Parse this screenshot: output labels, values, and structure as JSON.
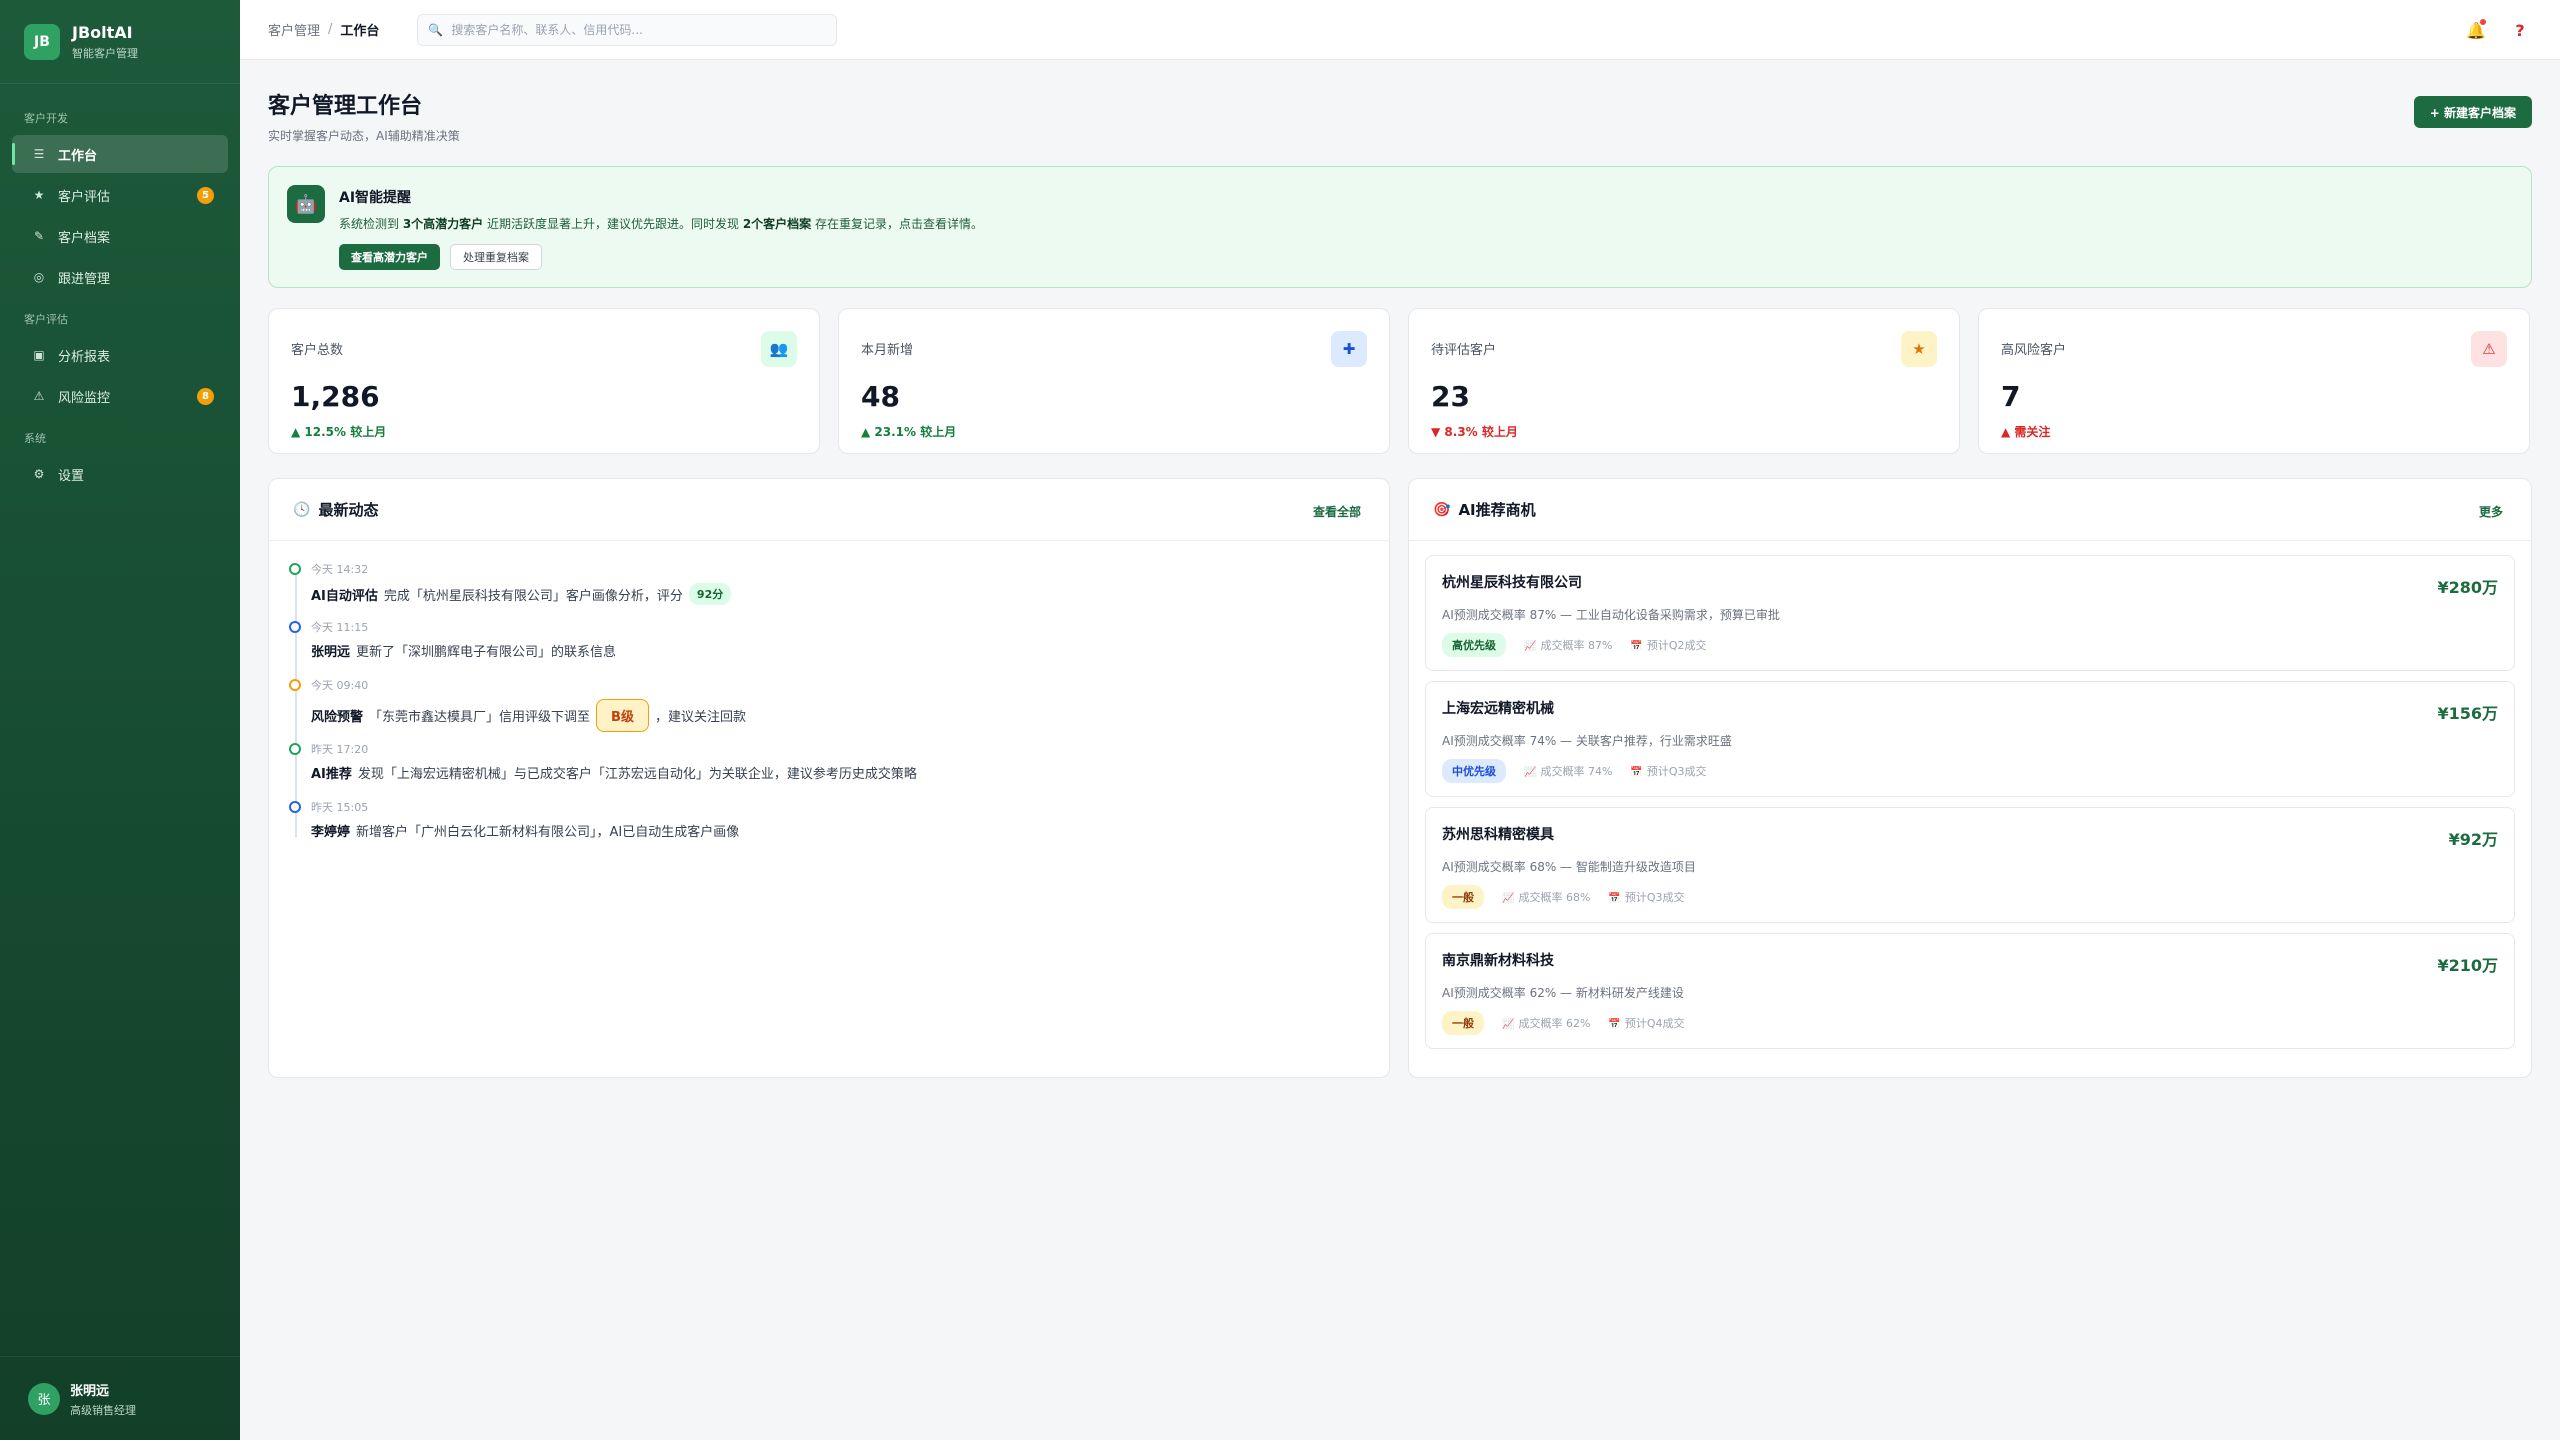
{
  "brand": {
    "logo": "JB",
    "name": "JBoltAI",
    "subtitle": "智能客户管理"
  },
  "sidebar": {
    "sections": [
      {
        "title": "客户开发",
        "items": [
          {
            "label": "工作台",
            "icon": "menu-icon",
            "active": true
          },
          {
            "label": "客户评估",
            "icon": "star-icon",
            "badge": "5"
          },
          {
            "label": "客户档案",
            "icon": "pen-icon"
          },
          {
            "label": "跟进管理",
            "icon": "target-icon"
          }
        ]
      },
      {
        "title": "客户评估",
        "items": [
          {
            "label": "分析报表",
            "icon": "report-icon"
          },
          {
            "label": "风险监控",
            "icon": "warning-icon",
            "badge": "8"
          }
        ]
      },
      {
        "title": "系统",
        "items": [
          {
            "label": "设置",
            "icon": "gear-icon"
          }
        ]
      }
    ]
  },
  "user": {
    "avatar": "张",
    "name": "张明远",
    "role": "高级销售经理"
  },
  "topbar": {
    "breadcrumb": [
      "客户管理",
      "工作台"
    ],
    "breadcrumb_sep": "/",
    "search_placeholder": "搜索客户名称、联系人、信用代码..."
  },
  "page": {
    "title": "客户管理工作台",
    "subtitle": "实时掌握客户动态，AI辅助精准决策",
    "new_button": "+ 新建客户档案"
  },
  "ai_alert": {
    "title": "AI智能提醒",
    "text_1": "系统检测到 ",
    "bold_1": "3个高潜力客户",
    "text_2": " 近期活跃度显著上升，建议优先跟进。同时发现 ",
    "bold_2": "2个客户档案",
    "text_3": " 存在重复记录，点击查看详情。",
    "primary_action": "查看高潜力客户",
    "secondary_action": "处理重复档案"
  },
  "stats": [
    {
      "label": "客户总数",
      "value": "1,286",
      "trend": "▲ 12.5% 较上月",
      "direction": "up",
      "icon": "👥",
      "icon_bg": "#dcfce7",
      "icon_color": "#166534"
    },
    {
      "label": "本月新增",
      "value": "48",
      "trend": "▲ 23.1% 较上月",
      "direction": "up",
      "icon": "✚",
      "icon_bg": "#dbeafe",
      "icon_color": "#1d4ed8"
    },
    {
      "label": "待评估客户",
      "value": "23",
      "trend": "▼ 8.3% 较上月",
      "direction": "down",
      "icon": "★",
      "icon_bg": "#fef3c7",
      "icon_color": "#d97706"
    },
    {
      "label": "高风险客户",
      "value": "7",
      "trend": "▲ 需关注",
      "direction": "down",
      "icon": "⚠",
      "icon_bg": "#fee2e2",
      "icon_color": "#dc2626"
    }
  ],
  "activity": {
    "title": "最新动态",
    "link": "查看全部",
    "items": [
      {
        "time": "今天 14:32",
        "actor": "AI自动评估",
        "text": "完成「杭州星辰科技有限公司」客户画像分析，评分",
        "score": "92分",
        "dot": "#22a35a"
      },
      {
        "time": "今天 11:15",
        "actor": "张明远",
        "text": "更新了「深圳鹏辉电子有限公司」的联系信息",
        "dot": "#2563eb"
      },
      {
        "time": "今天 09:40",
        "actor": "风险预警",
        "text": "「东莞市鑫达模具厂」信用评级下调至",
        "grade": "B级",
        "text_after": "，建议关注回款",
        "dot": "#f59e0b"
      },
      {
        "time": "昨天 17:20",
        "actor": "AI推荐",
        "text": "发现「上海宏远精密机械」与已成交客户「江苏宏远自动化」为关联企业，建议参考历史成交策略",
        "dot": "#22a35a"
      },
      {
        "time": "昨天 15:05",
        "actor": "李婷婷",
        "text": "新增客户「广州白云化工新材料有限公司」，AI已自动生成客户画像",
        "dot": "#2563eb"
      }
    ]
  },
  "opportunities": {
    "title": "AI推荐商机",
    "link": "更多",
    "items": [
      {
        "name": "杭州星辰科技有限公司",
        "amount": "¥280万",
        "desc": "AI预测成交概率 87% — 工业自动化设备采购需求，预算已审批",
        "tag": "高优先级",
        "tag_class": "tag-high",
        "prob": "成交概率 87%",
        "eta": "预计Q2成交"
      },
      {
        "name": "上海宏远精密机械",
        "amount": "¥156万",
        "desc": "AI预测成交概率 74% — 关联客户推荐，行业需求旺盛",
        "tag": "中优先级",
        "tag_class": "tag-mid",
        "prob": "成交概率 74%",
        "eta": "预计Q3成交"
      },
      {
        "name": "苏州思科精密模具",
        "amount": "¥92万",
        "desc": "AI预测成交概率 68% — 智能制造升级改造项目",
        "tag": "一般",
        "tag_class": "tag-low",
        "prob": "成交概率 68%",
        "eta": "预计Q3成交"
      },
      {
        "name": "南京鼎新材料科技",
        "amount": "¥210万",
        "desc": "AI预测成交概率 62% — 新材料研发产线建设",
        "tag": "一般",
        "tag_class": "tag-low",
        "prob": "成交概率 62%",
        "eta": "预计Q4成交"
      }
    ]
  }
}
